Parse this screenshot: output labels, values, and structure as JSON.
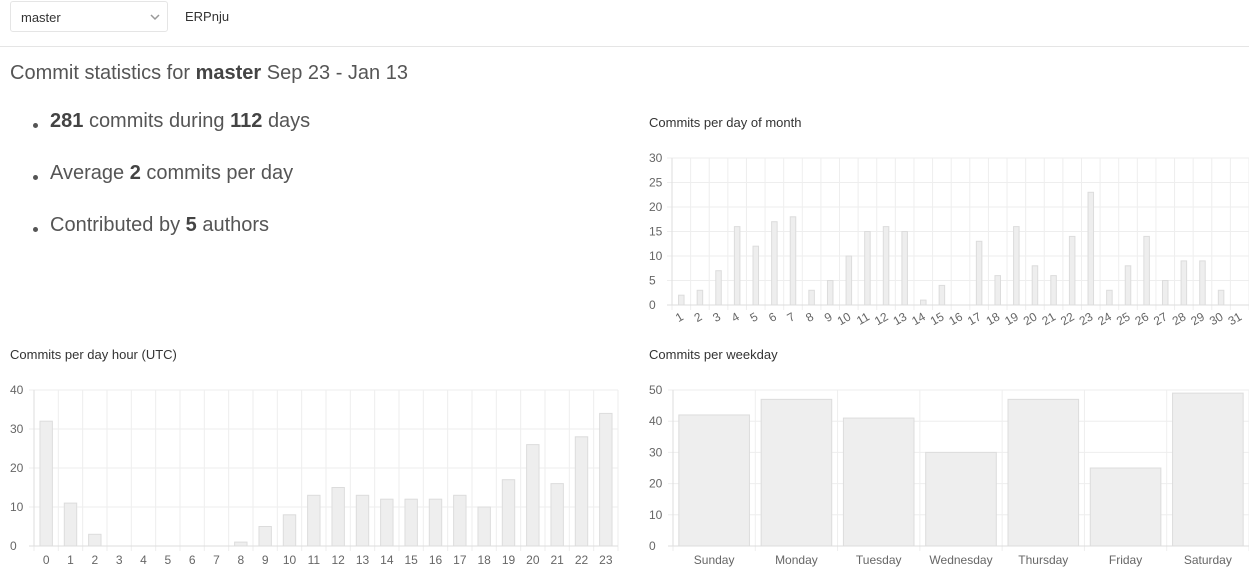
{
  "topbar": {
    "branch_value": "master",
    "project_name": "ERPnju"
  },
  "header": {
    "prefix": "Commit statistics for",
    "branch": "master",
    "range": "Sep 23 - Jan 13"
  },
  "summary": {
    "commits_count": "281",
    "commits_mid": "commits during",
    "days_count": "112",
    "days_suffix": "days",
    "avg_prefix": "Average",
    "avg_value": "2",
    "avg_suffix": "commits per day",
    "contrib_prefix": "Contributed by",
    "authors_count": "5",
    "authors_suffix": "authors"
  },
  "colors": {
    "bar_fill": "#eeeeee",
    "bar_stroke": "#dcdcdc",
    "grid": "#eeeeee"
  },
  "chart_data": [
    {
      "type": "bar",
      "title": "Commits per day of month",
      "categories": [
        "1",
        "2",
        "3",
        "4",
        "5",
        "6",
        "7",
        "8",
        "9",
        "10",
        "11",
        "12",
        "13",
        "14",
        "15",
        "16",
        "17",
        "18",
        "19",
        "20",
        "21",
        "22",
        "23",
        "24",
        "25",
        "26",
        "27",
        "28",
        "29",
        "30",
        "31"
      ],
      "values": [
        2,
        3,
        7,
        16,
        12,
        17,
        18,
        3,
        5,
        10,
        15,
        16,
        15,
        1,
        4,
        0,
        13,
        6,
        16,
        8,
        6,
        14,
        23,
        3,
        8,
        14,
        5,
        9,
        9,
        3,
        0
      ],
      "ylim": [
        0,
        30
      ],
      "yticks": [
        0,
        5,
        10,
        15,
        20,
        25,
        30
      ],
      "rotate_labels": true
    },
    {
      "type": "bar",
      "title": "Commits per day hour (UTC)",
      "categories": [
        "0",
        "1",
        "2",
        "3",
        "4",
        "5",
        "6",
        "7",
        "8",
        "9",
        "10",
        "11",
        "12",
        "13",
        "14",
        "15",
        "16",
        "17",
        "18",
        "19",
        "20",
        "21",
        "22",
        "23"
      ],
      "values": [
        32,
        11,
        3,
        0,
        0,
        0,
        0,
        0,
        1,
        5,
        8,
        13,
        15,
        13,
        12,
        12,
        12,
        13,
        10,
        17,
        26,
        16,
        28,
        34
      ],
      "ylim": [
        0,
        40
      ],
      "yticks": [
        0,
        10,
        20,
        30,
        40
      ]
    },
    {
      "type": "bar",
      "title": "Commits per weekday",
      "categories": [
        "Sunday",
        "Monday",
        "Tuesday",
        "Wednesday",
        "Thursday",
        "Friday",
        "Saturday"
      ],
      "values": [
        42,
        47,
        41,
        30,
        47,
        25,
        49
      ],
      "ylim": [
        0,
        50
      ],
      "yticks": [
        0,
        10,
        20,
        30,
        40,
        50
      ]
    }
  ]
}
